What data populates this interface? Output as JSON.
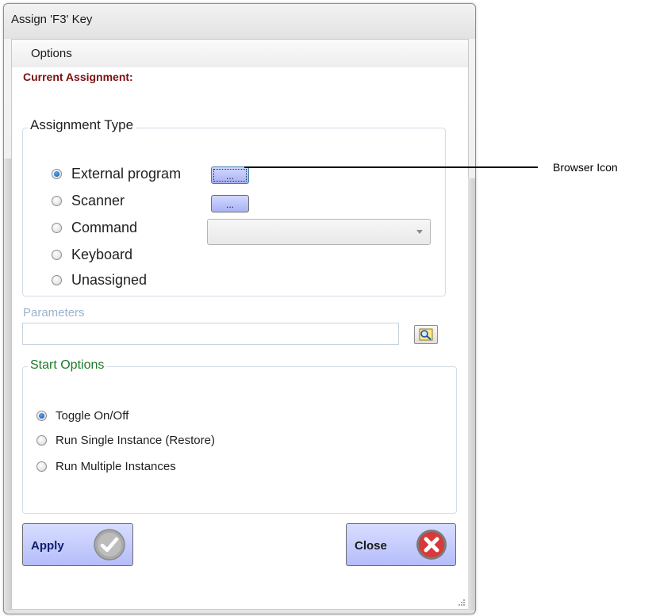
{
  "window": {
    "title": "Assign 'F3' Key"
  },
  "menu": {
    "options_label": "Options"
  },
  "current_assignment": {
    "label": "Current Assignment:"
  },
  "assignment_type": {
    "title": "Assignment Type",
    "options": [
      "External program",
      "Scanner",
      "Command",
      "Keyboard",
      "Unassigned"
    ],
    "selected": "External program",
    "browse_button_label": "...",
    "command_select_value": ""
  },
  "parameters": {
    "label": "Parameters",
    "value": ""
  },
  "start_options": {
    "title": "Start Options",
    "options": [
      "Toggle On/Off",
      "Run Single Instance (Restore)",
      "Run Multiple Instances"
    ],
    "selected": "Toggle On/Off"
  },
  "buttons": {
    "apply_label": "Apply",
    "close_label": "Close"
  },
  "annotation": {
    "label": "Browser Icon"
  },
  "icons": {
    "apply": "check-icon",
    "close": "close-x-icon",
    "parameters_browse": "search-icon",
    "resize": "resize-grip-icon"
  },
  "colors": {
    "current_assignment": "#7a1010",
    "start_options_title": "#1b7a2a",
    "parameters_label": "#9ab3cc",
    "button_fill": "#c3c9fc",
    "close_icon_red": "#d63a3a"
  }
}
